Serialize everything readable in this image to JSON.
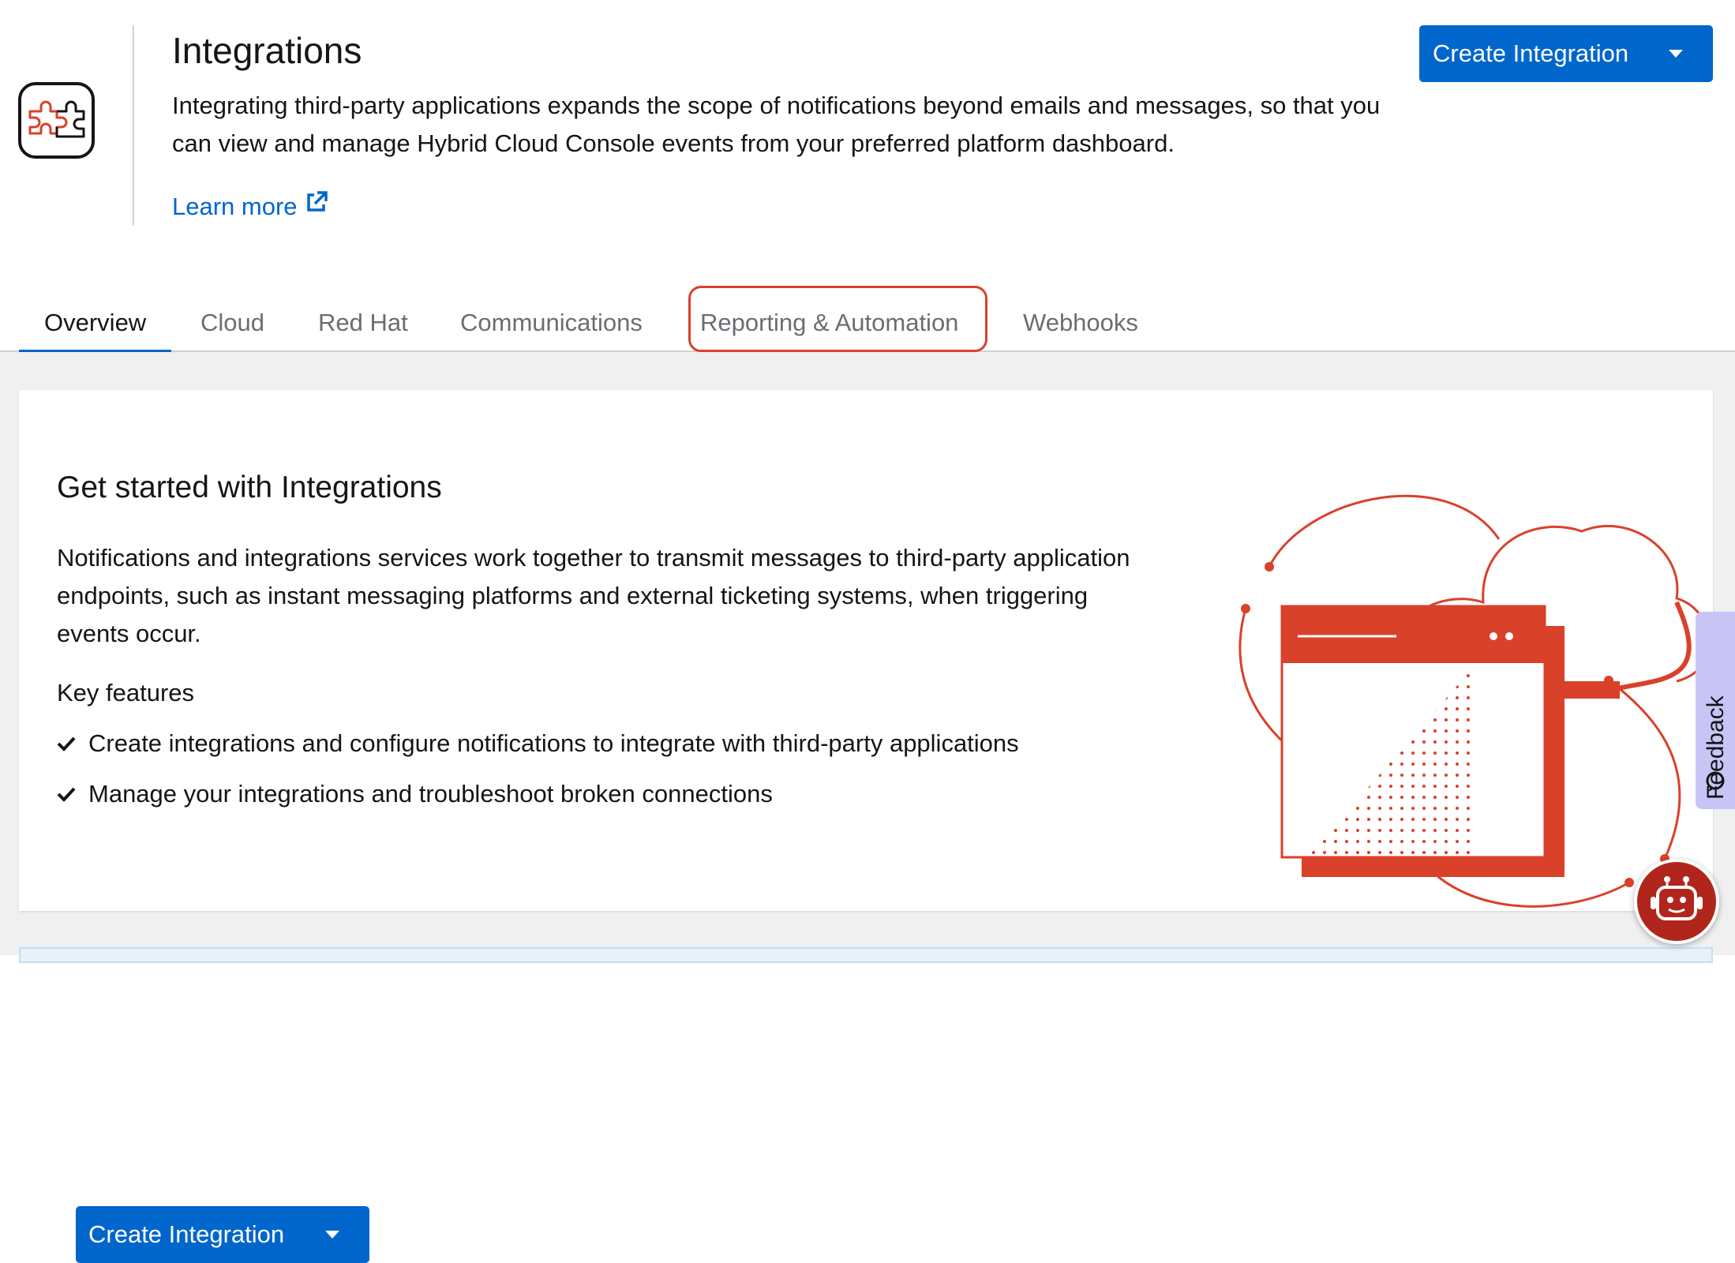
{
  "header": {
    "title": "Integrations",
    "description": "Integrating third-party applications expands the scope of notifications beyond emails and messages, so that you can view and manage Hybrid Cloud Console events from your preferred platform dashboard.",
    "learn_more": "Learn more",
    "create_button": "Create Integration",
    "icon": "puzzle-piece-icon"
  },
  "tabs": [
    {
      "label": "Overview",
      "active": true
    },
    {
      "label": "Cloud"
    },
    {
      "label": "Red Hat"
    },
    {
      "label": "Communications"
    },
    {
      "label": "Reporting & Automation",
      "highlighted": true
    },
    {
      "label": "Webhooks"
    }
  ],
  "card": {
    "title": "Get started with Integrations",
    "description": "Notifications and integrations services work together to transmit messages to third-party application endpoints, such as instant messaging platforms and external ticketing systems, when triggering events occur.",
    "features_title": "Key features",
    "features": [
      "Create integrations and configure notifications to integrate with third-party applications",
      "Manage your integrations and troubleshoot broken connections"
    ],
    "create_button": "Create Integration"
  },
  "feedback": {
    "label": "Feedback"
  },
  "colors": {
    "primary": "#0066cc",
    "accent_red": "#d9412b",
    "feedback_bg": "#c8c4f5",
    "chatbot_bg": "#b1261c"
  }
}
